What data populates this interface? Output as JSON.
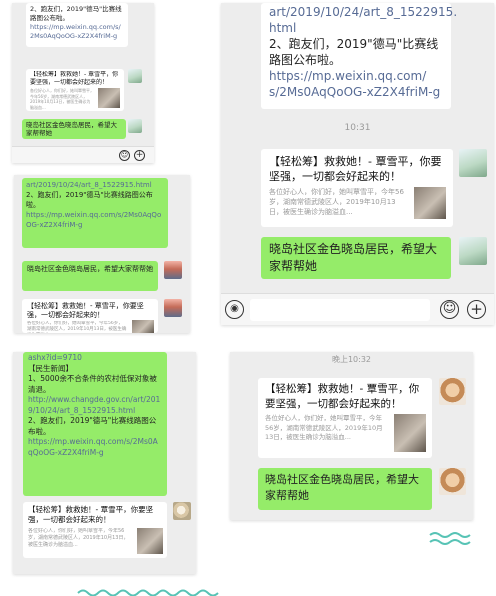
{
  "link_lines": [
    "art/2019/10/24/art_8_1522915.",
    "html"
  ],
  "link_lines_b": [
    "art/2019/10/24/art_8_1522915.html"
  ],
  "msg2_text": "2、跑友们，2019\"德马\"比赛线路图公布啦。",
  "mp_url": "https://mp.weixin.qq.com/s/2Ms0AqQoOG-xZ2X4friM-g",
  "mp_url_lines": [
    "https://mp.weixin.qq.com/",
    "s/2Ms0AqQoOG-xZ2X4friM-g"
  ],
  "time_1": "10:31",
  "time_2": "晚上10:32",
  "card_title": "【轻松筹】救救她！- 覃雪平，你要坚强，一切都会好起来的！",
  "card_desc": "各位好心人，你们好，她叫覃雪平，今年56岁，湖南常德武陵区人，2019年10月13日，被医生确诊为脑溢血...",
  "green_msg": "晓岛社区金色晓岛居民，希望大家帮帮她",
  "news_top": "ashx?id=9710",
  "news_header": "【民生新闻】",
  "news_item1": "1、5000余不合条件的农村低保对象被清退。",
  "news_url": "http://www.changde.gov.cn/art/2019/10/24/art_8_1522915.html",
  "icons": {
    "voice": "voice-icon",
    "emoji": "emoji-icon",
    "add": "add-icon"
  },
  "colors": {
    "chat_bg": "#ededed",
    "bubble_green": "#95ec69",
    "link": "#576b95",
    "muted": "#999999"
  }
}
